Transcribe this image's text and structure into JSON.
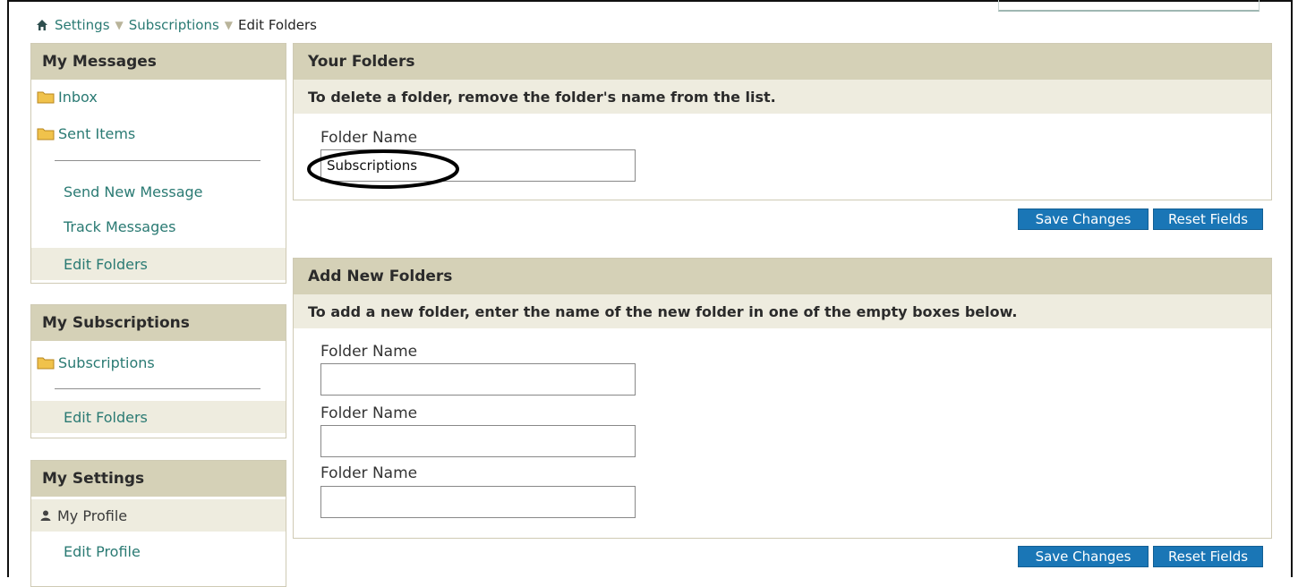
{
  "breadcrumb": {
    "items": [
      "Settings",
      "Subscriptions"
    ],
    "current": "Edit Folders"
  },
  "sidebar": {
    "messages": {
      "title": "My Messages",
      "folders": [
        "Inbox",
        "Sent Items"
      ],
      "links": [
        "Send New Message",
        "Track Messages",
        "Edit Folders"
      ]
    },
    "subscriptions": {
      "title": "My Subscriptions",
      "folders": [
        "Subscriptions"
      ],
      "links": [
        "Edit Folders"
      ]
    },
    "settings": {
      "title": "My Settings",
      "profile_label": "My Profile",
      "links": [
        "Edit Profile"
      ]
    }
  },
  "your_folders": {
    "title": "Your Folders",
    "instruction": "To delete a folder, remove the folder's name from the list.",
    "field_label": "Folder Name",
    "folder_value": "Subscriptions",
    "save_label": "Save Changes",
    "reset_label": "Reset Fields"
  },
  "add_folders": {
    "title": "Add New Folders",
    "instruction": "To add a new folder, enter the name of the new folder in one of the empty boxes below.",
    "field_labels": [
      "Folder Name",
      "Folder Name",
      "Folder Name"
    ],
    "values": [
      "",
      "",
      ""
    ],
    "save_label": "Save Changes",
    "reset_label": "Reset Fields"
  },
  "colors": {
    "header_bg": "#d5d1b7",
    "subheader_bg": "#eeecdf",
    "link": "#2a7a73",
    "button": "#1a76b6"
  },
  "icons": [
    "home-icon",
    "breadcrumb-separator-icon",
    "folder-icon",
    "user-icon"
  ]
}
